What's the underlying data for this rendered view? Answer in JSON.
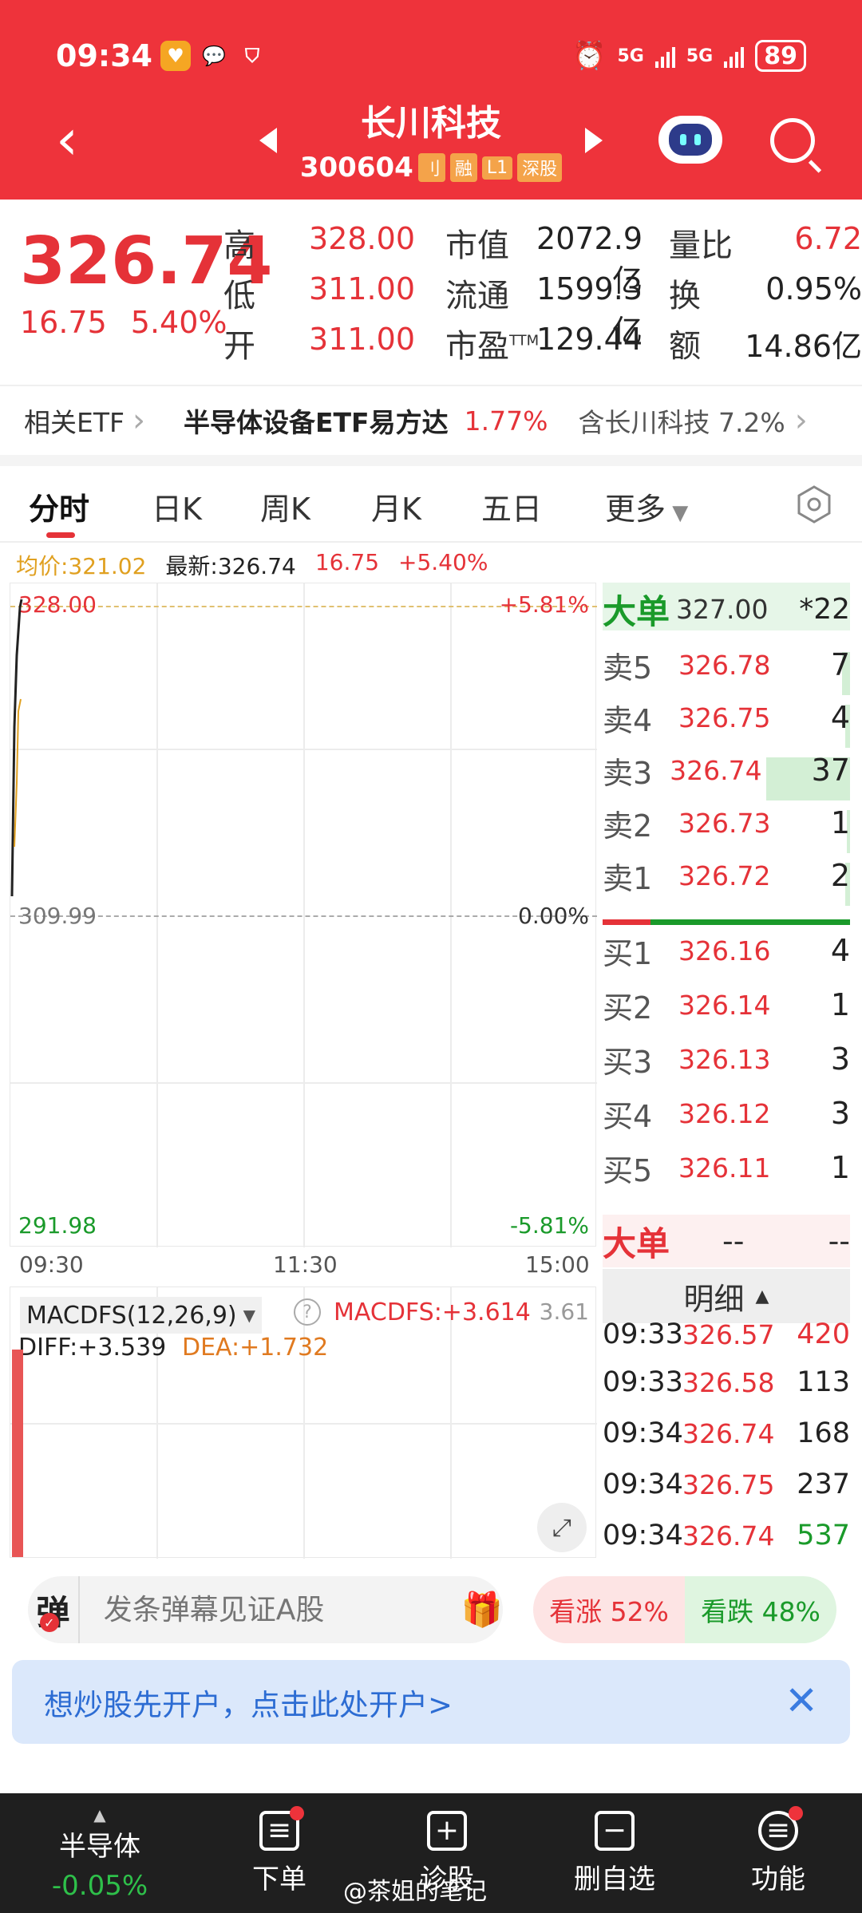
{
  "status_bar": {
    "time": "09:34",
    "net1": "5G",
    "net2": "5G",
    "battery": "89"
  },
  "header": {
    "back_icon": "chevron-left-icon",
    "stock_name": "长川科技",
    "stock_code": "300604",
    "tags": [
      "刂",
      "融",
      "L1",
      "深股"
    ],
    "assistant_icon": "robot-icon",
    "search_icon": "search-icon"
  },
  "quote": {
    "price": "326.74",
    "change": "16.75",
    "change_pct": "5.40%",
    "col1": [
      {
        "label": "高",
        "value": "328.00"
      },
      {
        "label": "低",
        "value": "311.00"
      },
      {
        "label": "开",
        "value": "311.00"
      }
    ],
    "col2": [
      {
        "label": "市值",
        "value": "2072.9亿"
      },
      {
        "label": "流通",
        "value": "1599.3亿"
      },
      {
        "label": "市盈",
        "sup": "TTM",
        "value": "129.44"
      }
    ],
    "col3": [
      {
        "label": "量比",
        "value": "6.72"
      },
      {
        "label": "换",
        "value": "0.95%"
      },
      {
        "label": "额",
        "value": "14.86亿"
      }
    ]
  },
  "etf_row": {
    "label": "相关ETF",
    "etf_name": "半导体设备ETF易方达",
    "etf_pct": "1.77%",
    "holding_text": "含长川科技 7.2%"
  },
  "tabs": [
    "分时",
    "日K",
    "周K",
    "月K",
    "五日",
    "更多"
  ],
  "info_line": {
    "avg": "均价:321.02",
    "latest": "最新:326.74",
    "chg": "16.75",
    "pct": "+5.40%"
  },
  "chart": {
    "top_price": "328.00",
    "top_pct": "+5.81%",
    "mid_price": "309.99",
    "mid_pct": "0.00%",
    "bottom_price": "291.98",
    "bottom_pct": "-5.81%",
    "time_labels": [
      "09:30",
      "11:30",
      "15:00"
    ]
  },
  "macd": {
    "selector": "MACDFS(12,26,9)",
    "macdfs": "MACDFS:+3.614",
    "max": "3.61",
    "diff": "DIFF:+3.539",
    "dea": "DEA:+1.732"
  },
  "orderbook": {
    "big_label": "大单",
    "big_price": "327.00",
    "big_qty": "*22",
    "asks": [
      {
        "label": "卖5",
        "price": "326.78",
        "qty": "7"
      },
      {
        "label": "卖4",
        "price": "326.75",
        "qty": "4"
      },
      {
        "label": "卖3",
        "price": "326.74",
        "qty": "37"
      },
      {
        "label": "卖2",
        "price": "326.73",
        "qty": "1"
      },
      {
        "label": "卖1",
        "price": "326.72",
        "qty": "2"
      }
    ],
    "bids": [
      {
        "label": "买1",
        "price": "326.16",
        "qty": "4"
      },
      {
        "label": "买2",
        "price": "326.14",
        "qty": "1"
      },
      {
        "label": "买3",
        "price": "326.13",
        "qty": "3"
      },
      {
        "label": "买4",
        "price": "326.12",
        "qty": "3"
      },
      {
        "label": "买5",
        "price": "326.11",
        "qty": "1"
      }
    ],
    "big2_label": "大单",
    "big2_a": "--",
    "big2_b": "--"
  },
  "detail": {
    "header": "明细",
    "ticks": [
      {
        "time": "09:33",
        "price": "326.57",
        "vol": "420",
        "color": "#e53238"
      },
      {
        "time": "09:33",
        "price": "326.58",
        "vol": "113",
        "color": "#222222"
      },
      {
        "time": "09:34",
        "price": "326.74",
        "vol": "168",
        "color": "#222222"
      },
      {
        "time": "09:34",
        "price": "326.75",
        "vol": "237",
        "color": "#222222"
      },
      {
        "time": "09:34",
        "price": "326.74",
        "vol": "537",
        "color": "#1a9a2a"
      }
    ]
  },
  "danmu": {
    "button": "弹",
    "placeholder": "发条弹幕见证A股",
    "bull": "看涨 52%",
    "bear": "看跌 48%"
  },
  "banner": {
    "text": "想炒股先开户，点击此处开户>"
  },
  "tabbar": {
    "sector_name": "半导体",
    "sector_pct": "-0.05%",
    "order": "下单",
    "diagnose": "诊股",
    "remove": "删自选",
    "function": "功能"
  },
  "watermark": "@茶姐的笔记",
  "colors": {
    "header_red": "#ee333b",
    "up": "#e53238",
    "down": "#1a9a2a"
  }
}
